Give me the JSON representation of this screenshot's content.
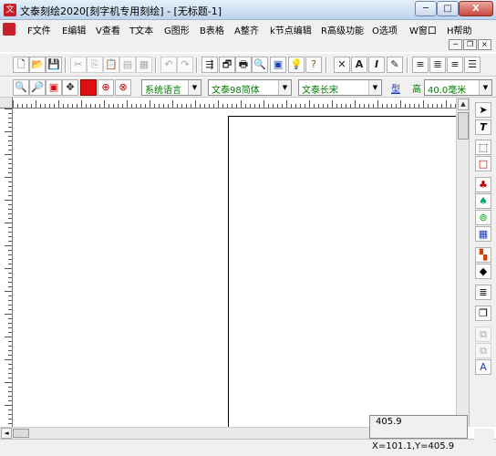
{
  "window": {
    "title": "文泰刻绘2020[刻字机专用刻绘] - [无标题-1]",
    "min_label": "─",
    "max_label": "□",
    "close_label": "X"
  },
  "menu": [
    {
      "label": "F文件"
    },
    {
      "label": "E编辑"
    },
    {
      "label": "V查看"
    },
    {
      "label": "T文本"
    },
    {
      "label": "G图形"
    },
    {
      "label": "B表格"
    },
    {
      "label": "A整齐"
    },
    {
      "label": "k节点编辑"
    },
    {
      "label": "R高级功能"
    },
    {
      "label": "O选项"
    },
    {
      "label": "W窗口"
    },
    {
      "label": "H帮助"
    }
  ],
  "mdi": {
    "min_label": "─",
    "restore_label": "❐",
    "close_label": "×"
  },
  "toolbar2": {
    "language": "系统语言",
    "font_cn": "文泰98简体",
    "font_en": "文泰长宋",
    "type_label": "型",
    "height_label": "高",
    "height_value": "40.0毫米"
  },
  "status": {
    "coord_partial": "405.9",
    "coord_full": "X=101.1,Y=405.9"
  }
}
